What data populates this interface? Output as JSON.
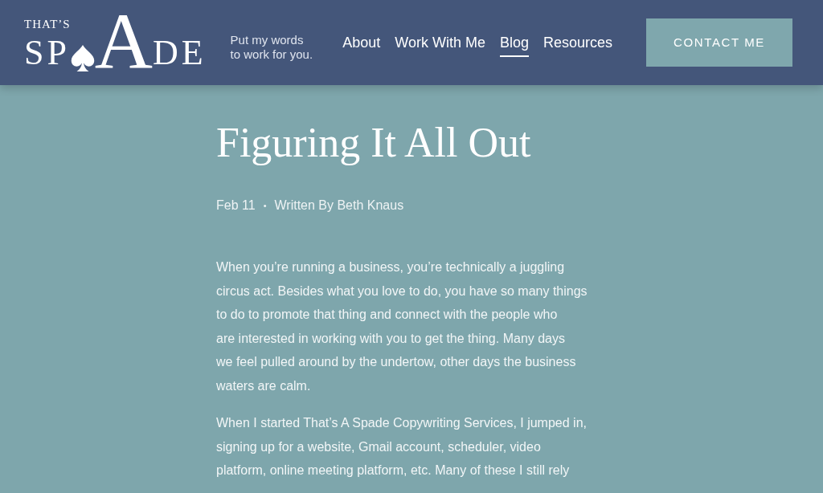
{
  "header": {
    "logo": {
      "small_text": "THAT’S",
      "letters_left": "SP",
      "letter_accent": "A",
      "letters_right": "DE"
    },
    "tagline": [
      "Put my words",
      "to work for you."
    ],
    "nav": [
      {
        "label": "About",
        "selected": false
      },
      {
        "label": "Work With Me",
        "selected": false
      },
      {
        "label": "Blog",
        "selected": true
      },
      {
        "label": "Resources",
        "selected": false
      }
    ],
    "contact_button": "CONTACT ME"
  },
  "post": {
    "title": "Figuring It All Out",
    "date": "Feb 11",
    "separator": "•",
    "author_line": "Written By Beth Knaus",
    "paragraphs": [
      [
        "When you’re running a business, you’re technically a juggling",
        "circus act. Besides what you love to do, you have so many things",
        "to do to promote that thing and connect with the people who",
        "are interested in working with you to get the thing. Many days",
        "we feel pulled around by the undertow, other days the business",
        "waters are calm."
      ],
      [
        "When I started That’s A Spade Copywriting Services, I jumped in,",
        "signing up for a website, Gmail account, scheduler, video",
        "platform, online meeting platform, etc. Many of these I still rely"
      ]
    ]
  }
}
